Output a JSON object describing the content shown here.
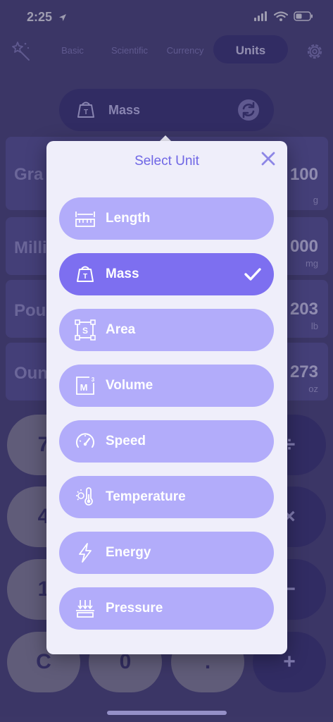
{
  "status": {
    "time": "2:25"
  },
  "tabs": [
    {
      "label": "Basic"
    },
    {
      "label": "Scientific"
    },
    {
      "label": "Currency"
    },
    {
      "label": "Units"
    }
  ],
  "converter": {
    "category": "Mass"
  },
  "rows": [
    {
      "name": "Gra",
      "value": "100",
      "unit": "g"
    },
    {
      "name": "Milli",
      "value": "000",
      "unit": "mg"
    },
    {
      "name": "Pou",
      "value": "203",
      "unit": "lb"
    },
    {
      "name": "Oun",
      "value": "273",
      "unit": "oz"
    }
  ],
  "keypad": {
    "left": [
      "7",
      "4",
      "1",
      "C"
    ],
    "bottom_mid": [
      "0",
      "."
    ],
    "right": [
      "÷",
      "×",
      "−",
      "+"
    ]
  },
  "modal": {
    "title": "Select Unit",
    "items": [
      {
        "label": "Length",
        "icon": "ruler-icon",
        "selected": false
      },
      {
        "label": "Mass",
        "icon": "weight-icon",
        "selected": true
      },
      {
        "label": "Area",
        "icon": "area-icon",
        "selected": false
      },
      {
        "label": "Volume",
        "icon": "volume-icon",
        "selected": false
      },
      {
        "label": "Speed",
        "icon": "speedometer-icon",
        "selected": false
      },
      {
        "label": "Temperature",
        "icon": "thermometer-icon",
        "selected": false
      },
      {
        "label": "Energy",
        "icon": "lightning-icon",
        "selected": false
      },
      {
        "label": "Pressure",
        "icon": "pressure-icon",
        "selected": false
      }
    ]
  },
  "colors": {
    "background": "#4c4679",
    "accent": "#7d6ff0",
    "item": "#b2acfa",
    "modal": "#efeefa"
  }
}
